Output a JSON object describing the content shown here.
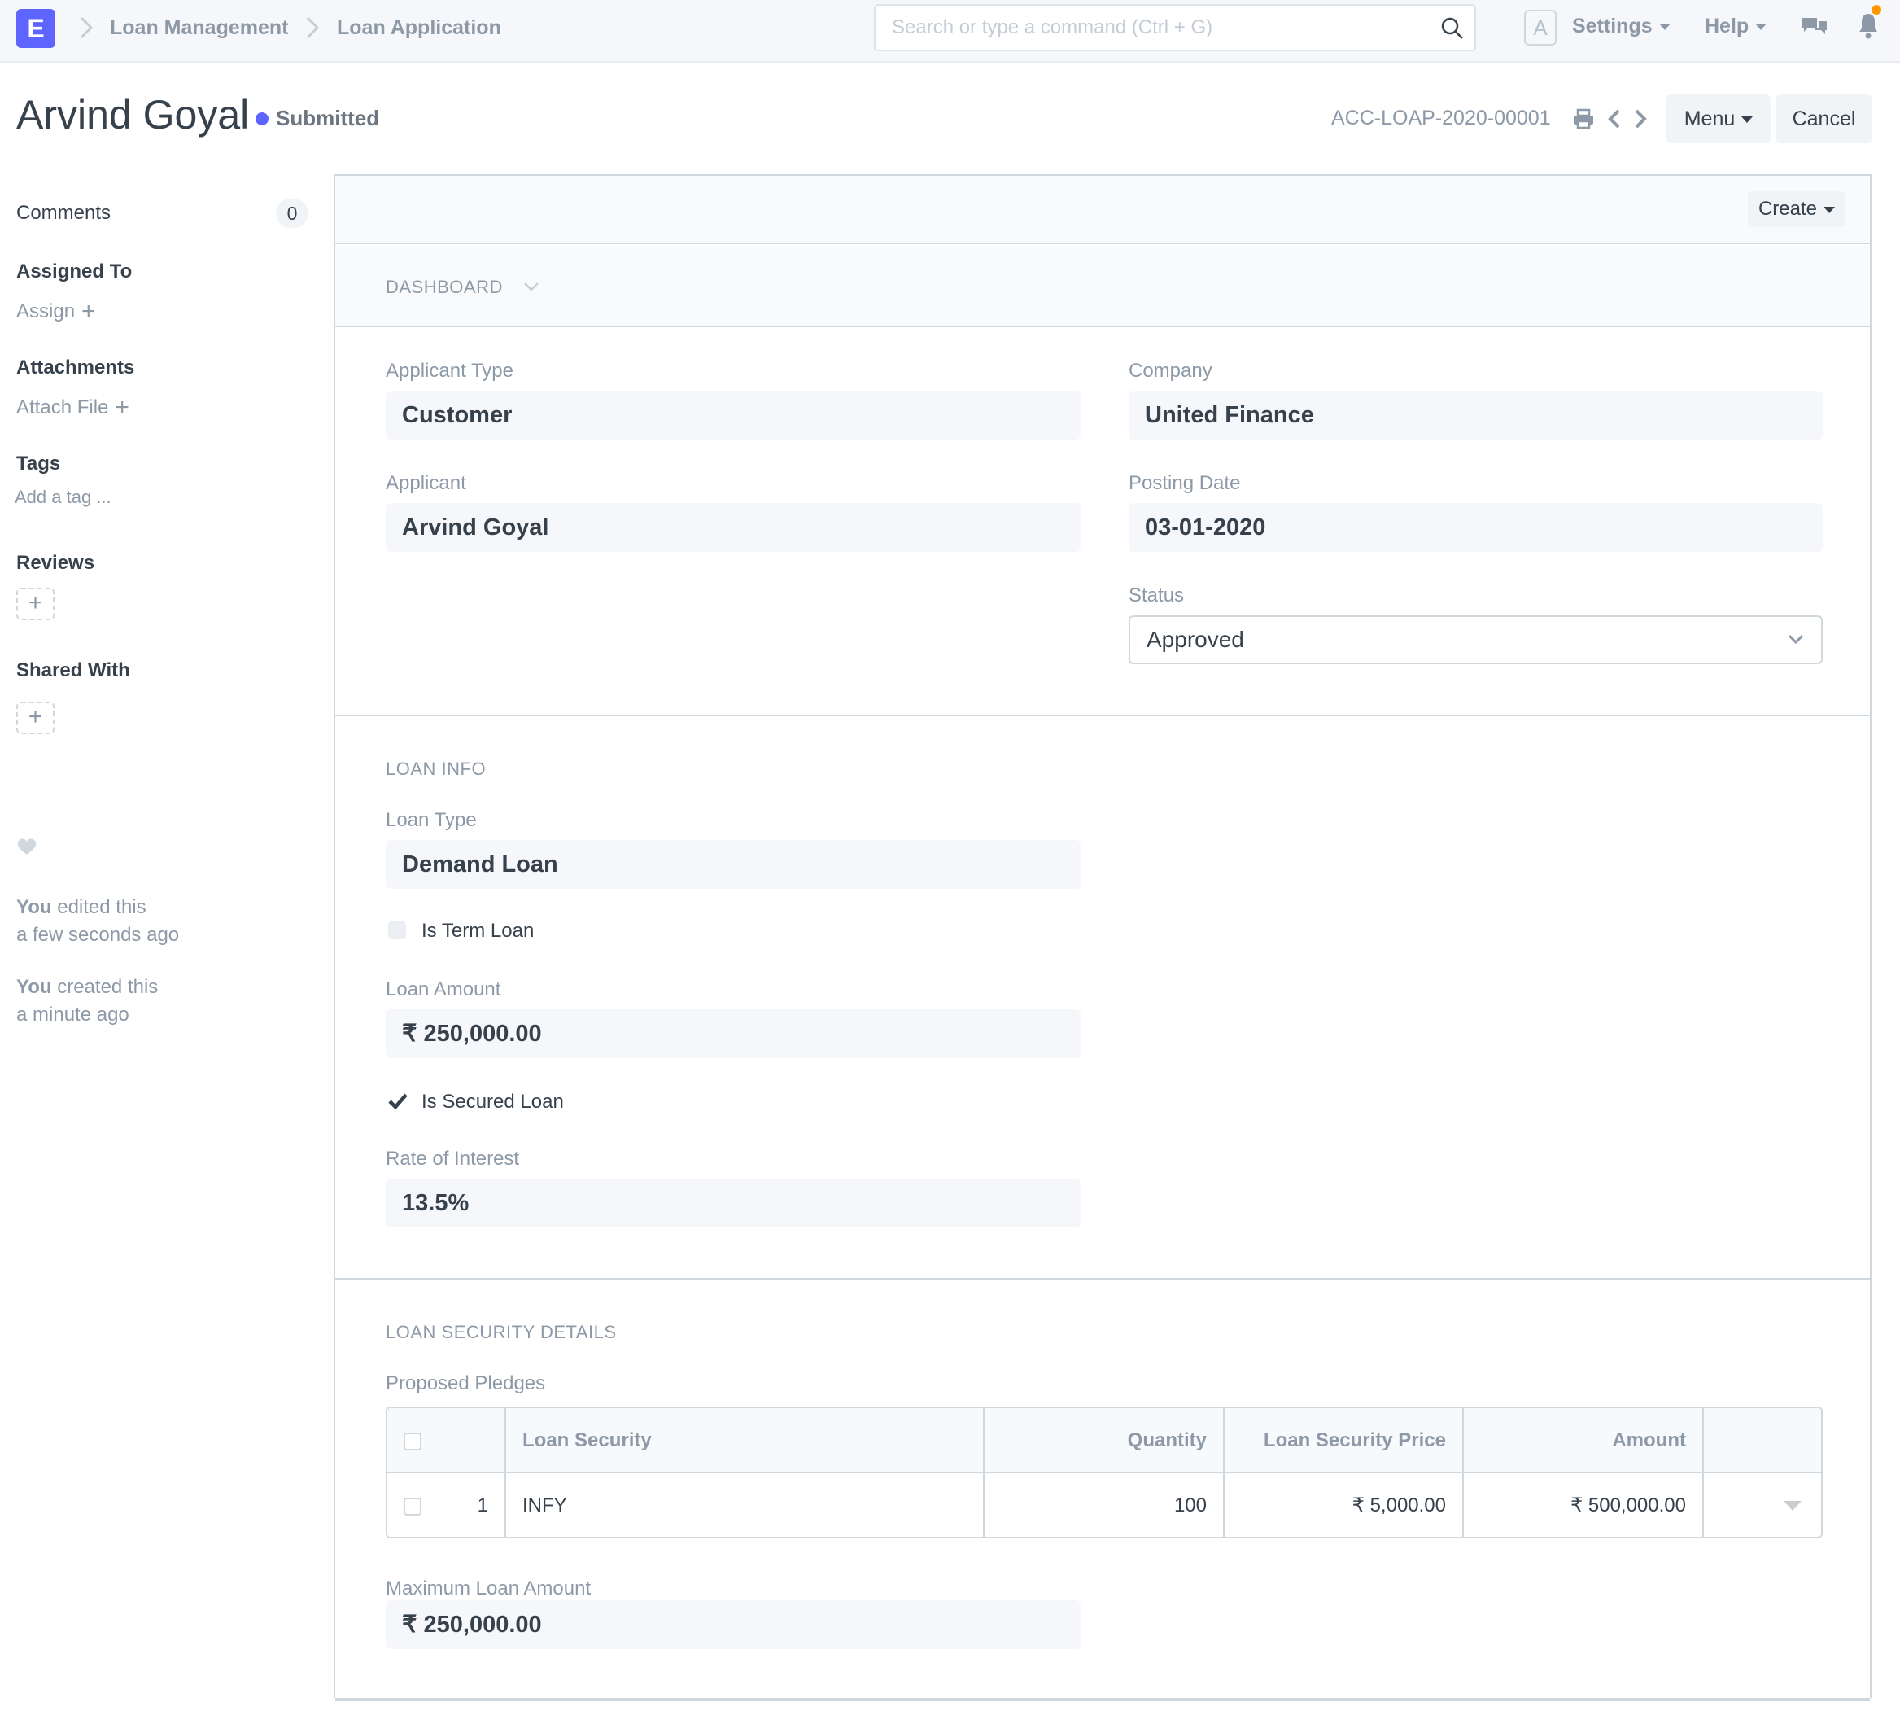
{
  "navbar": {
    "logo_letter": "E",
    "breadcrumbs": [
      "Loan Management",
      "Loan Application"
    ],
    "search_placeholder": "Search or type a command (Ctrl + G)",
    "avatar_letter": "A",
    "settings_label": "Settings",
    "help_label": "Help",
    "notification_dot_color": "#ff9800"
  },
  "title_bar": {
    "title": "Arvind Goyal",
    "status": "Submitted",
    "status_color": "#5e64ff",
    "doc_id": "ACC-LOAP-2020-00001",
    "menu_label": "Menu",
    "cancel_label": "Cancel"
  },
  "sidebar": {
    "comments_label": "Comments",
    "comments_count": "0",
    "assigned_to_heading": "Assigned To",
    "assign_link": "Assign",
    "attachments_heading": "Attachments",
    "attach_file_link": "Attach File",
    "tags_heading": "Tags",
    "add_tag_placeholder": "Add a tag ...",
    "reviews_heading": "Reviews",
    "shared_with_heading": "Shared With",
    "timeline": [
      {
        "actor": "You",
        "action": "edited this",
        "time": "a few seconds ago"
      },
      {
        "actor": "You",
        "action": "created this",
        "time": "a minute ago"
      }
    ]
  },
  "main": {
    "create_label": "Create",
    "dashboard_section": "DASHBOARD",
    "fields": {
      "applicant_type": {
        "label": "Applicant Type",
        "value": "Customer"
      },
      "company": {
        "label": "Company",
        "value": "United Finance"
      },
      "applicant": {
        "label": "Applicant",
        "value": "Arvind Goyal"
      },
      "posting_date": {
        "label": "Posting Date",
        "value": "03-01-2020"
      },
      "status": {
        "label": "Status",
        "value": "Approved"
      }
    },
    "loan_info": {
      "section_title": "LOAN INFO",
      "loan_type": {
        "label": "Loan Type",
        "value": "Demand Loan"
      },
      "is_term_loan": {
        "label": "Is Term Loan",
        "checked": false
      },
      "loan_amount": {
        "label": "Loan Amount",
        "value": "₹ 250,000.00"
      },
      "is_secured_loan": {
        "label": "Is Secured Loan",
        "checked": true
      },
      "rate_of_interest": {
        "label": "Rate of Interest",
        "value": "13.5%"
      }
    },
    "loan_security": {
      "section_title": "LOAN SECURITY DETAILS",
      "proposed_pledges_label": "Proposed Pledges",
      "columns": [
        "Loan Security",
        "Quantity",
        "Loan Security Price",
        "Amount"
      ],
      "rows": [
        {
          "idx": "1",
          "loan_security": "INFY",
          "quantity": "100",
          "price": "₹ 5,000.00",
          "amount": "₹ 500,000.00"
        }
      ],
      "maximum_loan_amount": {
        "label": "Maximum Loan Amount",
        "value": "₹ 250,000.00"
      }
    }
  }
}
